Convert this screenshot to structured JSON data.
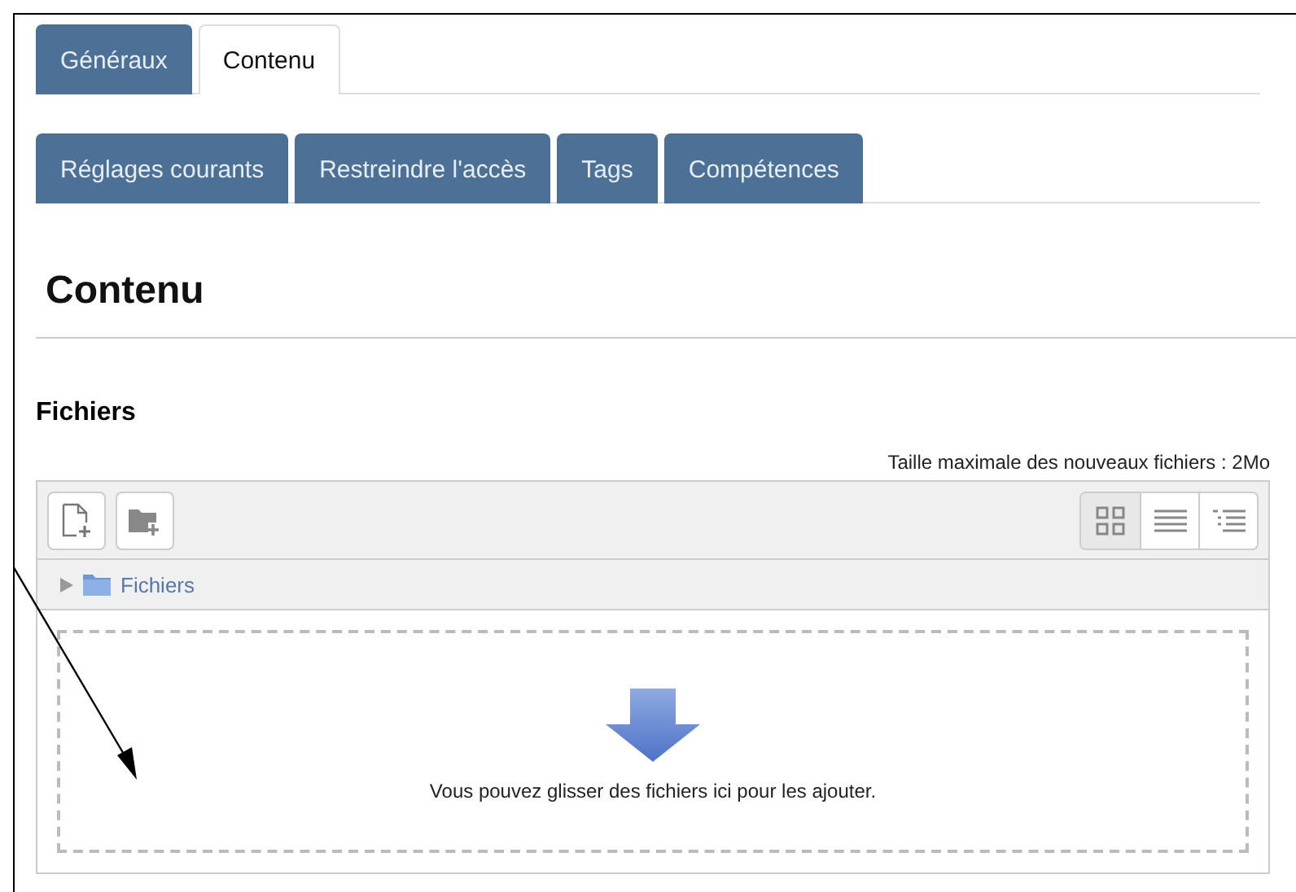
{
  "tabs": [
    {
      "label": "Généraux",
      "selected": false
    },
    {
      "label": "Contenu",
      "selected": true
    }
  ],
  "subtabs": [
    {
      "label": "Réglages courants",
      "selected": false
    },
    {
      "label": "Restreindre l'accès",
      "selected": false
    },
    {
      "label": "Tags",
      "selected": false
    },
    {
      "label": "Compétences",
      "selected": false
    }
  ],
  "heading": "Contenu",
  "section": {
    "title": "Fichiers",
    "max_size": "Taille maximale des nouveaux fichiers : 2Mo",
    "views": [
      {
        "kind": "grid",
        "selected": true
      },
      {
        "kind": "list",
        "selected": false
      },
      {
        "kind": "tree",
        "selected": false
      }
    ],
    "path": "Fichiers",
    "drop_hint": "Vous pouvez glisser des fichiers ici pour les ajouter."
  }
}
